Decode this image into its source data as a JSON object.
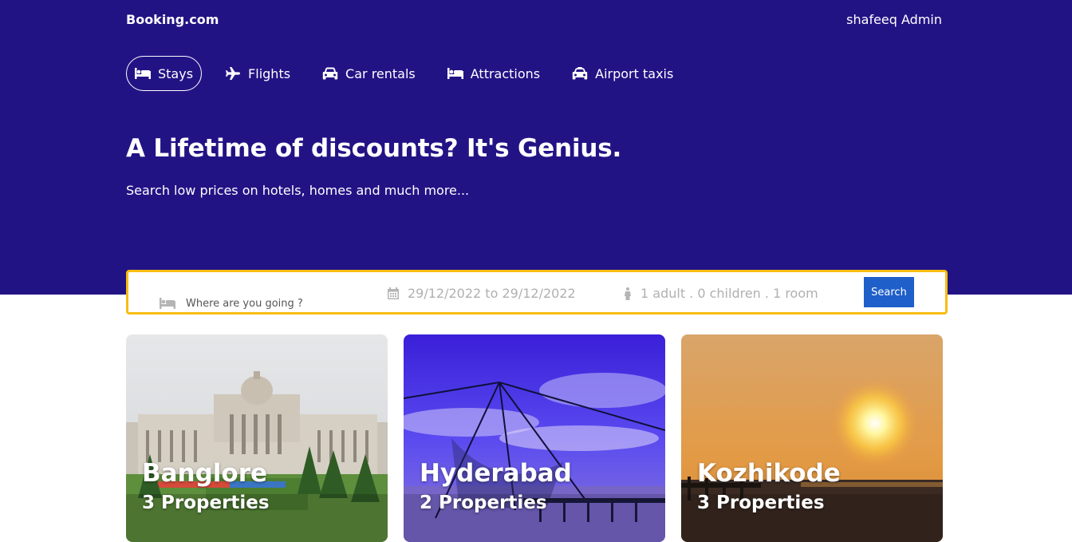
{
  "header": {
    "logo": "Booking.com",
    "user": "shafeeq Admin",
    "headline": "A Lifetime of discounts? It's Genius.",
    "subline": "Search low prices on hotels, homes and much more..."
  },
  "nav": {
    "items": [
      {
        "label": "Stays",
        "icon": "bed-icon",
        "active": true
      },
      {
        "label": "Flights",
        "icon": "plane-icon",
        "active": false
      },
      {
        "label": "Car rentals",
        "icon": "car-icon",
        "active": false
      },
      {
        "label": "Attractions",
        "icon": "bed-icon",
        "active": false
      },
      {
        "label": "Airport taxis",
        "icon": "taxi-icon",
        "active": false
      }
    ]
  },
  "search": {
    "destination_placeholder": "Where are you going ?",
    "dates": "29/12/2022 to 29/12/2022",
    "guests": "1 adult . 0 children . 1 room",
    "button": "Search"
  },
  "featured": [
    {
      "city": "Banglore",
      "properties": "3 Properties"
    },
    {
      "city": "Hyderabad",
      "properties": "2 Properties"
    },
    {
      "city": "Kozhikode",
      "properties": "3 Properties"
    }
  ],
  "colors": {
    "header_bg": "#221385",
    "search_border": "#f7bd10",
    "search_button": "#1f5fc9"
  }
}
